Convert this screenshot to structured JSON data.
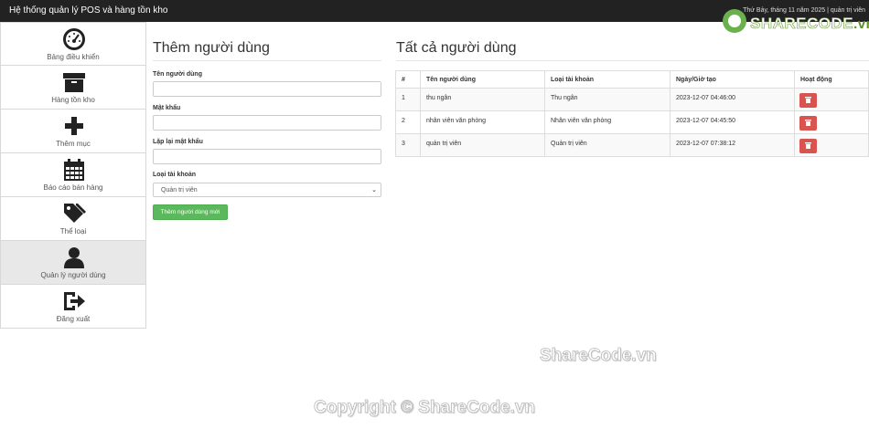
{
  "app": {
    "title": "Hệ thống quản lý POS và hàng tồn kho",
    "status": "Thứ Bảy, tháng 11 năm 2025 | quản trị viên"
  },
  "logo": {
    "brand_main": "SHARECODE",
    "brand_suffix": ".vn"
  },
  "sidebar": {
    "items": [
      {
        "label": "Bảng điều khiển",
        "icon": "dashboard-icon"
      },
      {
        "label": "Hàng tồn kho",
        "icon": "box-icon"
      },
      {
        "label": "Thêm mục",
        "icon": "plus-icon"
      },
      {
        "label": "Báo cáo bán hàng",
        "icon": "calendar-icon"
      },
      {
        "label": "Thể loại",
        "icon": "tags-icon"
      },
      {
        "label": "Quản lý người dùng",
        "icon": "user-icon",
        "active": true
      },
      {
        "label": "Đăng xuất",
        "icon": "logout-icon"
      }
    ]
  },
  "form": {
    "title": "Thêm người dùng",
    "username_label": "Tên người dùng",
    "username_value": "",
    "password_label": "Mật khẩu",
    "password_value": "",
    "repeat_password_label": "Lặp lại mật khẩu",
    "repeat_password_value": "",
    "account_type_label": "Loại tài khoản",
    "account_type_selected": "Quản trị viên",
    "submit_label": "Thêm người dùng mới"
  },
  "users": {
    "title": "Tất cả người dùng",
    "columns": [
      "#",
      "Tên người dùng",
      "Loại tài khoản",
      "Ngày/Giờ tạo",
      "Hoạt động"
    ],
    "rows": [
      {
        "id": "1",
        "name": "thu ngân",
        "type": "Thu ngân",
        "created": "2023-12-07 04:46:00"
      },
      {
        "id": "2",
        "name": "nhân viên văn phòng",
        "type": "Nhân viên văn phòng",
        "created": "2023-12-07 04:45:50"
      },
      {
        "id": "3",
        "name": "quản trị viên",
        "type": "Quản trị viên",
        "created": "2023-12-07 07:38:12"
      }
    ]
  },
  "watermarks": {
    "mid": "ShareCode.vn",
    "bottom": "Copyright © ShareCode.vn"
  },
  "colors": {
    "topbar": "#222222",
    "success": "#5cb85c",
    "danger": "#d9534f",
    "sidebar_active": "#e8e8e8"
  }
}
